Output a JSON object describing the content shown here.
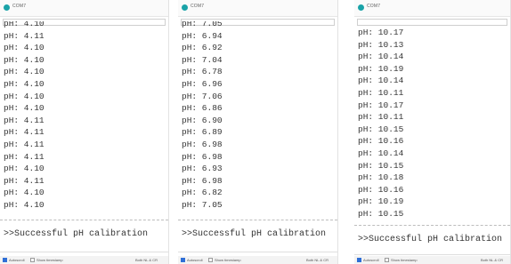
{
  "windows": [
    {
      "title": "COM7",
      "lines": [
        "pH: 4.10",
        "pH: 4.11",
        "pH: 4.10",
        "pH: 4.10",
        "pH: 4.10",
        "pH: 4.10",
        "pH: 4.10",
        "pH: 4.10",
        "pH: 4.11",
        "pH: 4.11",
        "pH: 4.11",
        "pH: 4.11",
        "pH: 4.10",
        "pH: 4.11",
        "pH: 4.10",
        "pH: 4.10"
      ],
      "success_text": ">>Successful pH calibration",
      "autoscroll_label": "Autoscroll",
      "timestamp_label": "Show timestamp",
      "line_ending": "Both NL & CR",
      "autoscroll_checked": true,
      "timestamp_checked": false
    },
    {
      "title": "COM7",
      "lines": [
        "pH: 7.05",
        "pH: 6.94",
        "pH: 6.92",
        "pH: 7.04",
        "pH: 6.78",
        "pH: 6.96",
        "pH: 7.06",
        "pH: 6.86",
        "pH: 6.90",
        "pH: 6.89",
        "pH: 6.98",
        "pH: 6.98",
        "pH: 6.93",
        "pH: 6.98",
        "pH: 6.82",
        "pH: 7.05"
      ],
      "success_text": ">>Successful pH calibration",
      "autoscroll_label": "Autoscroll",
      "timestamp_label": "Show timestamp",
      "line_ending": "Both NL & CR",
      "autoscroll_checked": true,
      "timestamp_checked": false
    },
    {
      "title": "COM7",
      "lines": [
        "pH: 10.17",
        "pH: 10.13",
        "pH: 10.14",
        "pH: 10.19",
        "pH: 10.14",
        "pH: 10.11",
        "pH: 10.17",
        "pH: 10.11",
        "pH: 10.15",
        "pH: 10.16",
        "pH: 10.14",
        "pH: 10.15",
        "pH: 10.18",
        "pH: 10.16",
        "pH: 10.19",
        "pH: 10.15"
      ],
      "success_text": ">>Successful pH calibration",
      "autoscroll_label": "Autoscroll",
      "timestamp_label": "Show timestamp",
      "line_ending": "Both NL & CR",
      "autoscroll_checked": true,
      "timestamp_checked": false
    }
  ],
  "colors": {
    "app_icon": "#1aa3a8",
    "checkbox_on": "#2f6fd6",
    "text": "#333333"
  },
  "icons": {
    "app": "serial-monitor-icon"
  }
}
